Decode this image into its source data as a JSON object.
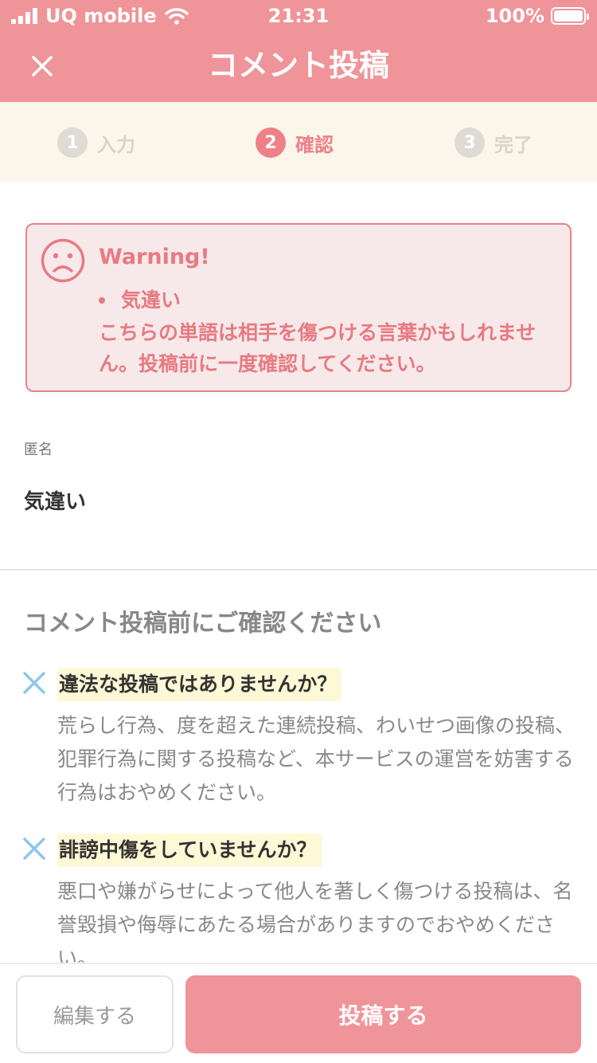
{
  "status_bar": {
    "carrier": "UQ mobile",
    "time": "21:31",
    "battery": "100%",
    "icons": [
      "signal-icon",
      "wifi-icon",
      "battery-icon"
    ]
  },
  "header": {
    "title": "コメント投稿",
    "close_icon": "close-icon"
  },
  "steps": [
    {
      "number": "1",
      "label": "入力",
      "active": false
    },
    {
      "number": "2",
      "label": "確認",
      "active": true
    },
    {
      "number": "3",
      "label": "完了",
      "active": false
    }
  ],
  "warning": {
    "icon": "sad-face-icon",
    "title": "Warning!",
    "word": "気違い",
    "message": "こちらの単語は相手を傷つける言葉かもしれません。投稿前に一度確認してください。"
  },
  "comment": {
    "author": "匿名",
    "text": "気違い"
  },
  "notice": {
    "heading": "コメント投稿前にご確認ください",
    "items": [
      {
        "icon": "cross-icon",
        "title": "違法な投稿ではありませんか？",
        "body": "荒らし行為、度を超えた連続投稿、わいせつ画像の投稿、犯罪行為に関する投稿など、本サービスの運営を妨害する行為はおやめください。"
      },
      {
        "icon": "cross-icon",
        "title": "誹謗中傷をしていませんか？",
        "body": "悪口や嫌がらせによって他人を著しく傷つける投稿は、名誉毀損や侮辱にあたる場合がありますのでおやめください。"
      }
    ]
  },
  "actions": {
    "edit_label": "編集する",
    "post_label": "投稿する"
  },
  "colors": {
    "accent": "#ef9499",
    "warning_text": "#e87a82",
    "steps_bg": "#fbf6ea",
    "highlight": "#fdf9d6",
    "cross": "#8ec8ea"
  }
}
